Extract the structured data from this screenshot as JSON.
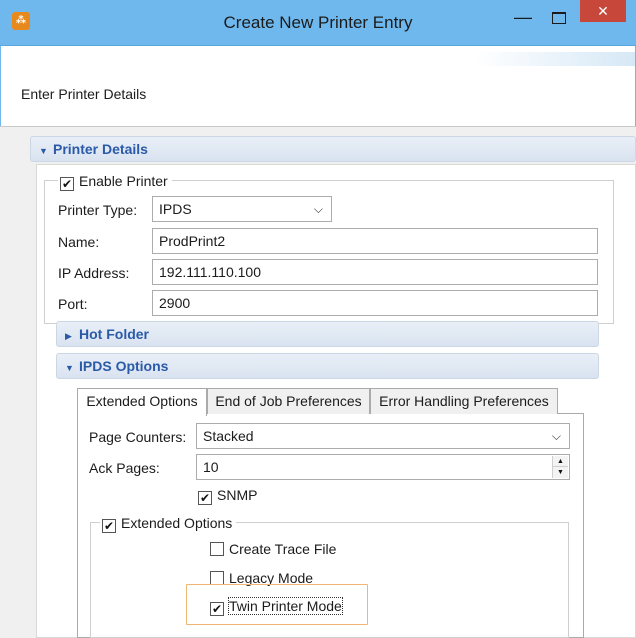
{
  "window": {
    "title": "Create New Printer Entry",
    "minimize_glyph": "—",
    "close_glyph": "✕",
    "icon": "printer-app-icon"
  },
  "header": {
    "text": "Enter Printer Details"
  },
  "printer_details": {
    "section_title": "Printer Details",
    "enable_label": "Enable Printer",
    "enable_checked": true,
    "type_label": "Printer Type:",
    "type_value": "IPDS",
    "name_label": "Name:",
    "name_value": "ProdPrint2",
    "ip_label": "IP Address:",
    "ip_value": "192.111.110.100",
    "port_label": "Port:",
    "port_value": "2900"
  },
  "hot_folder": {
    "section_title": "Hot Folder"
  },
  "ipds_options": {
    "section_title": "IPDS Options",
    "tabs": [
      {
        "label": "Extended Options",
        "active": true
      },
      {
        "label": "End of Job Preferences",
        "active": false
      },
      {
        "label": "Error Handling Preferences",
        "active": false
      }
    ],
    "page_counters_label": "Page Counters:",
    "page_counters_value": "Stacked",
    "ack_pages_label": "Ack Pages:",
    "ack_pages_value": "10",
    "snmp_label": "SNMP",
    "snmp_checked": true,
    "extended_group_label": "Extended Options",
    "extended_checked": true,
    "create_trace_label": "Create Trace File",
    "create_trace_checked": false,
    "legacy_mode_label": "Legacy Mode",
    "legacy_mode_checked": false,
    "twin_printer_label": "Twin Printer Mode",
    "twin_printer_checked": true
  },
  "colors": {
    "titlebar": "#6fb8ee",
    "close_button": "#c7483a",
    "section_header_text": "#2a5aa8",
    "highlight_border": "#f0b774"
  }
}
